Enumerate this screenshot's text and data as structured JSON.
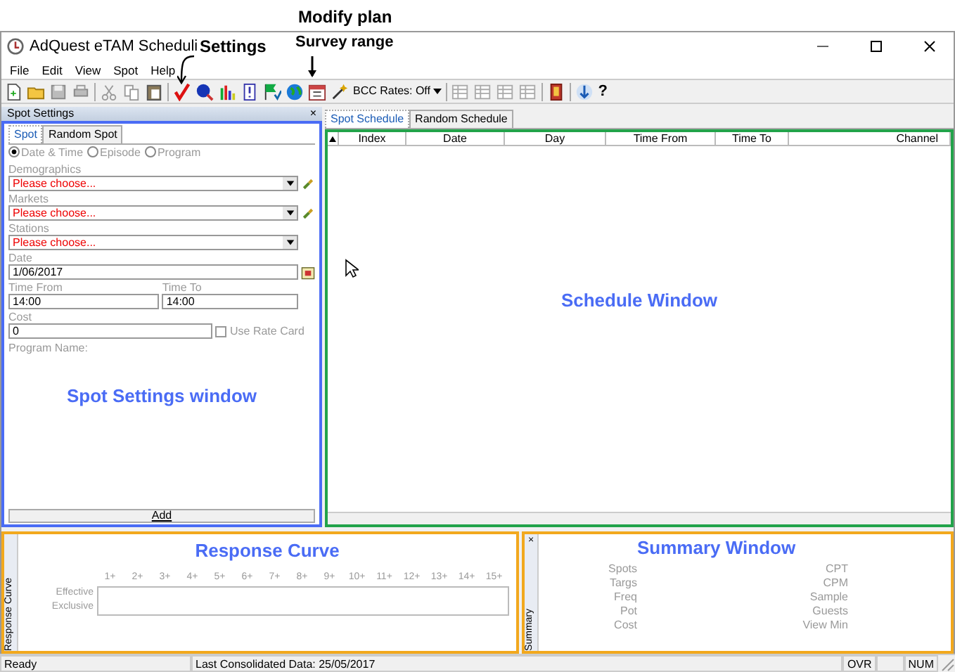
{
  "annotations": {
    "modify_plan": "Modify plan",
    "settings": "Settings",
    "survey_range": "Survey range",
    "spot_panel": "Spot Settings window",
    "schedule": "Schedule Window",
    "response": "Response Curve",
    "summary": "Summary Window"
  },
  "window": {
    "title": "AdQuest eTAM Scheduli"
  },
  "menu": [
    "File",
    "Edit",
    "View",
    "Spot",
    "Help"
  ],
  "toolbar": {
    "bcc_rates": "BCC Rates: Off",
    "help": "?"
  },
  "spot_settings": {
    "title": "Spot Settings",
    "close": "×",
    "tabs": [
      {
        "label": "Spot",
        "selected": true
      },
      {
        "label": "Random Spot",
        "selected": false
      }
    ],
    "modes": [
      {
        "label": "Date & Time",
        "selected": true
      },
      {
        "label": "Episode",
        "selected": false
      },
      {
        "label": "Program",
        "selected": false
      }
    ],
    "dropdowns": [
      {
        "label": "Demographics",
        "value": "Please choose...",
        "picker": true
      },
      {
        "label": "Markets",
        "value": "Please choose...",
        "picker": true
      },
      {
        "label": "Stations",
        "value": "Please choose...",
        "picker": false
      }
    ],
    "date": {
      "label": "Date",
      "value": "1/06/2017"
    },
    "time_from": {
      "label": "Time From",
      "value": "14:00"
    },
    "time_to": {
      "label": "Time To",
      "value": "14:00"
    },
    "cost": {
      "label": "Cost",
      "value": "0"
    },
    "use_rate_card": {
      "label": "Use Rate Card",
      "checked": false
    },
    "program_name": "Program Name:",
    "add_button": "Add"
  },
  "schedule": {
    "tabs": [
      {
        "label": "Spot Schedule",
        "selected": true
      },
      {
        "label": "Random Schedule",
        "selected": false
      }
    ],
    "columns": [
      "Index",
      "Date",
      "Day",
      "Time From",
      "Time To",
      "Channel"
    ]
  },
  "response_curve": {
    "side_label": "Response Curve",
    "headers": [
      "1+",
      "2+",
      "3+",
      "4+",
      "5+",
      "6+",
      "7+",
      "8+",
      "9+",
      "10+",
      "11+",
      "12+",
      "13+",
      "14+",
      "15+"
    ],
    "rows": [
      "Effective",
      "Exclusive"
    ]
  },
  "summary": {
    "close": "×",
    "side_label": "Summary",
    "left": [
      "Spots",
      "Targs",
      "Freq",
      "Pot",
      "Cost"
    ],
    "right": [
      "CPT",
      "CPM",
      "Sample",
      "Guests",
      "View Min"
    ]
  },
  "status_bar": {
    "ready": "Ready",
    "consolidated": "Last Consolidated Data: 25/05/2017",
    "ovr": "OVR",
    "num": "NUM"
  }
}
